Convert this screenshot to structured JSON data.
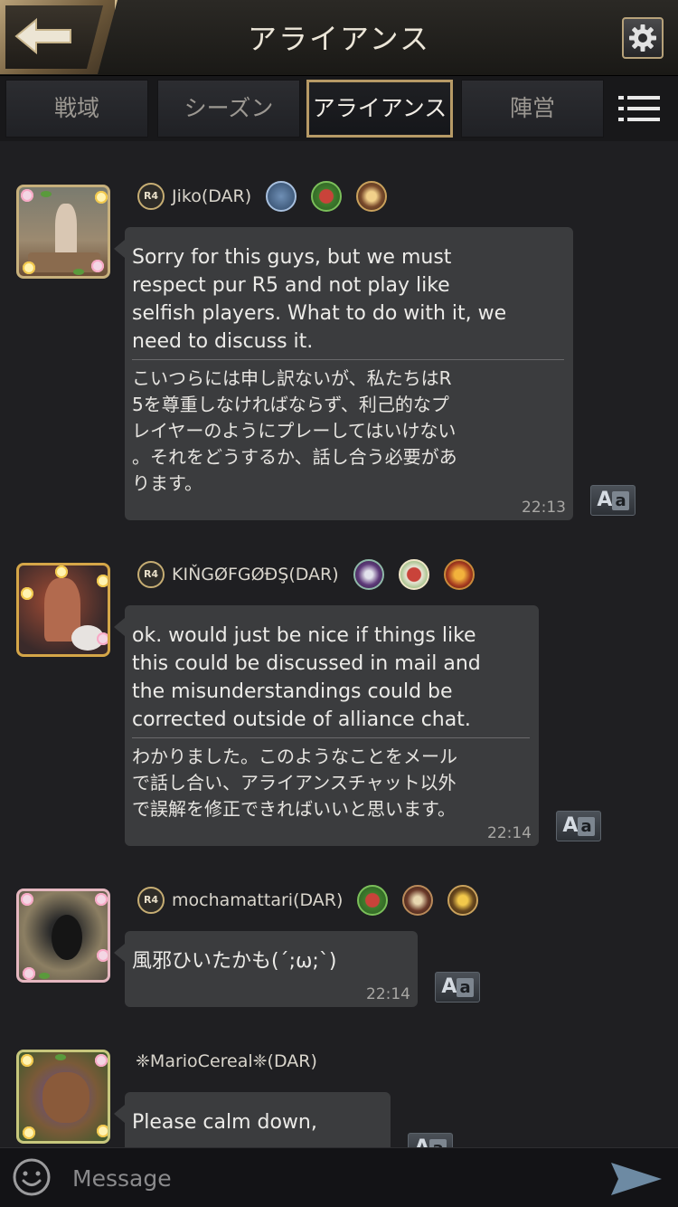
{
  "header": {
    "title": "アライアンス",
    "back_icon": "back-arrow-icon",
    "settings_icon": "gear-icon"
  },
  "tabs": [
    {
      "label": "戦域",
      "active": false
    },
    {
      "label": "シーズン",
      "active": false
    },
    {
      "label": "アライアンス",
      "active": true
    },
    {
      "label": "陣営",
      "active": false
    }
  ],
  "menu_icon": "list-menu-icon",
  "messages": [
    {
      "rank": "R4",
      "name": "Jiko(DAR)",
      "text_en": "Sorry for this guys, but we must\nrespect pur R5 and not play like\nselfish players. What to do with it, we\n need to discuss it.",
      "text_jp": "こいつらには申し訳ないが、私たちはR\n5を尊重しなければならず、利己的なプ\nレイヤーのようにプレーしてはいけない\n。それをどうするか、話し合う必要があ\nります。",
      "time": "22:13"
    },
    {
      "rank": "R4",
      "name": "KIŇGØFGØĐŞ(DAR)",
      "text_en": "ok. would just be nice if things like\nthis could be discussed in mail and\nthe misunderstandings could be\ncorrected outside of alliance chat.",
      "text_jp": "わかりました。このようなことをメール\nで話し合い、アライアンスチャット以外\nで誤解を修正できればいいと思います。",
      "time": "22:14"
    },
    {
      "rank": "R4",
      "name": "mochamattari(DAR)",
      "text_en": "風邪ひいたかも(´;ω;`)",
      "time": "22:14"
    },
    {
      "rank": "",
      "name": "❈MarioCereal❈(DAR)",
      "text_en": "Please calm down,"
    }
  ],
  "translate_label_big": "A",
  "translate_label_small": "a",
  "input": {
    "placeholder": "Message",
    "value": ""
  },
  "colors": {
    "accent_gold": "#b79a66",
    "bubble": "#3b3c3e",
    "background": "#1f1f22"
  }
}
